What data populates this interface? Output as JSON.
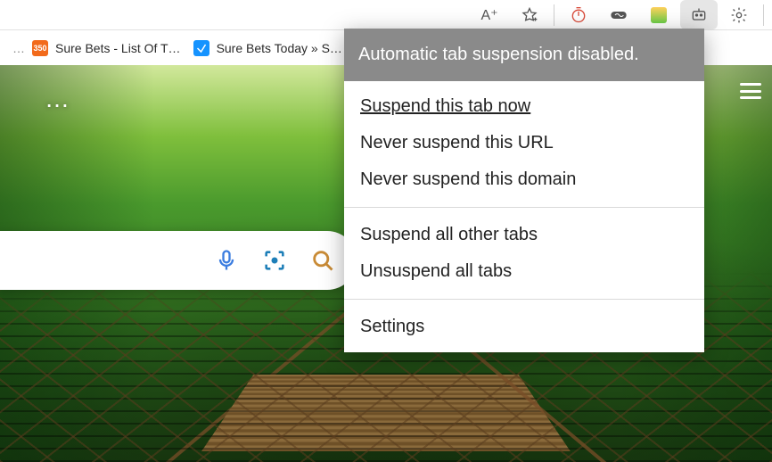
{
  "toolbar": {
    "read_aloud": "A⁺",
    "favorites": "star-plus",
    "ext_timer": "timer",
    "ext_loop": "loop",
    "ext_puzzle": "puzzle",
    "ext_suspender": "suspender-robot",
    "settings": "gear"
  },
  "bookmarks": [
    {
      "label": "Sure Bets - List Of T…",
      "icon_text": "350",
      "icon_bg": "#f26a1b"
    },
    {
      "label": "Sure Bets Today » S…",
      "icon_text": "",
      "icon_bg": "#1593ff"
    }
  ],
  "page": {
    "more": "…",
    "hamburger": "menu"
  },
  "search_icons": {
    "voice": "mic",
    "lens": "camera-scan",
    "search": "magnifier"
  },
  "popup": {
    "header": "Automatic tab suspension disabled.",
    "group1": [
      "Suspend this tab now",
      "Never suspend this URL",
      "Never suspend this domain"
    ],
    "group2": [
      "Suspend all other tabs",
      "Unsuspend all tabs"
    ],
    "group3": [
      "Settings"
    ]
  }
}
